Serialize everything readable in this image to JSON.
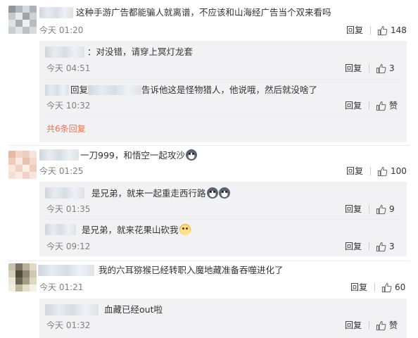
{
  "reply_label": "回复",
  "like_label": "赞",
  "comments": [
    {
      "text": "这种手游广告都能骗人就离谱，不应该和山海经广告当个双来看吗",
      "time": "今天 01:20",
      "likes": "148",
      "replies": [
        {
          "text": "：对没错，请穿上冥灯龙套",
          "time": "今天 04:51",
          "likes": "3"
        },
        {
          "prefix": "回复",
          "text": "告诉他这是怪物猎人，他说哦，然后就没啥了",
          "time": "今天 10:32",
          "likes": "赞"
        }
      ],
      "more_replies": "共6条回复"
    },
    {
      "text": "一刀999，和悟空一起攻沙",
      "time": "今天 01:25",
      "likes": "100",
      "replies": [
        {
          "text": "是兄弟，就来一起重走西行路",
          "time": "今天 01:35",
          "likes": "9"
        },
        {
          "text": "是兄弟，就来花果山砍我",
          "time": "今天 09:12",
          "likes": "3"
        }
      ]
    },
    {
      "text": "我的六耳猕猴已经转职入魔地藏准备吞噬进化了",
      "time": "今天 01:21",
      "likes": "60",
      "replies": [
        {
          "text": "血藏已经out啦",
          "time": "今天 01:32",
          "likes": "赞"
        }
      ]
    }
  ],
  "icons": {
    "like": "thumbs-up-icon",
    "emoji_dog": "dog-face-emoji-icon",
    "emoji_cat": "cat-face-emoji-icon"
  },
  "colors": {
    "more_link": "#eb7350",
    "subbox_bg": "#f2f2f5",
    "time": "#808080"
  }
}
